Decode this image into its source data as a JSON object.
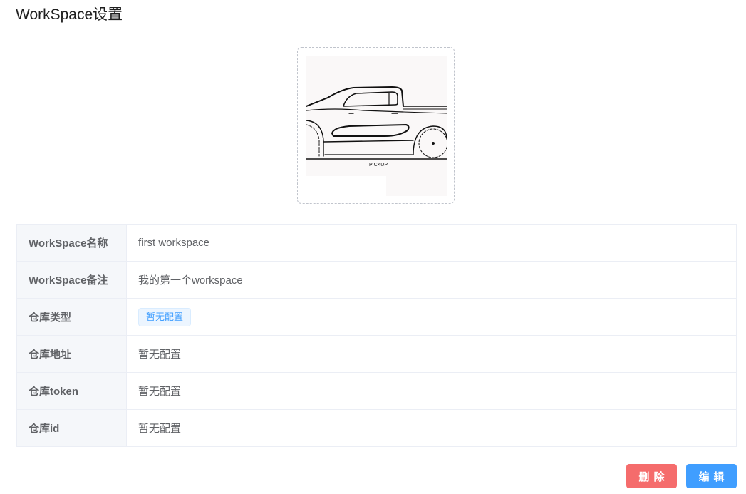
{
  "page": {
    "title": "WorkSpace设置"
  },
  "avatar": {
    "caption": "PICKUP"
  },
  "details": {
    "rows": [
      {
        "label": "WorkSpace名称",
        "value": "first workspace"
      },
      {
        "label": "WorkSpace备注",
        "value": "我的第一个workspace"
      },
      {
        "label": "仓库类型",
        "value": "暂无配置"
      },
      {
        "label": "仓库地址",
        "value": "暂无配置"
      },
      {
        "label": "仓库token",
        "value": "暂无配置"
      },
      {
        "label": "仓库id",
        "value": "暂无配置"
      }
    ]
  },
  "actions": {
    "delete_label": "删除",
    "edit_label": "编辑"
  },
  "colors": {
    "primary": "#409eff",
    "danger": "#f56c6c",
    "label_bg": "#f5f7fa",
    "border": "#ebeef5"
  }
}
